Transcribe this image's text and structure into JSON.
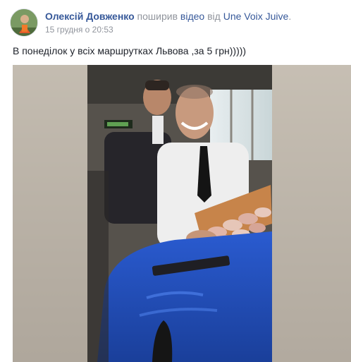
{
  "post": {
    "author_name": "Олексій Довженко",
    "action_text": " поширив ",
    "video_link": "відео",
    "from_text": " від ",
    "page_name": "Une Voix Juive",
    "trailing": ".",
    "timestamp": "15 грудня о 20:53",
    "message": "В понеділок у всіх маршрутках Львова ,за 5 грн)))))"
  },
  "colors": {
    "link": "#365899",
    "muted": "#90949c",
    "text": "#1d2129"
  }
}
